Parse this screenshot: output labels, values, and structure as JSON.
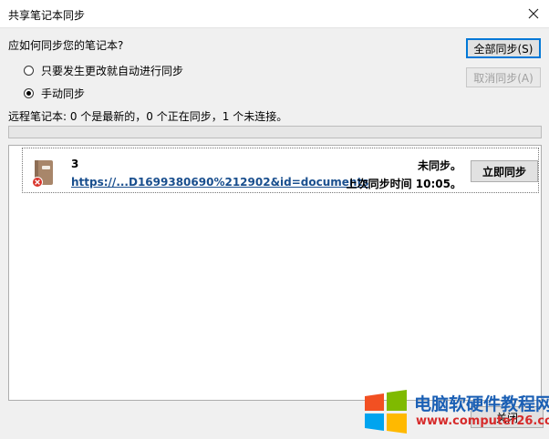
{
  "window": {
    "title": "共享笔记本同步"
  },
  "question": "应如何同步您的笔记本?",
  "options": [
    {
      "label": "只要发生更改就自动进行同步",
      "selected": false
    },
    {
      "label": "手动同步",
      "selected": true
    }
  ],
  "buttons": {
    "sync_all": "全部同步(S)",
    "cancel_sync": "取消同步(A)",
    "close": "关闭"
  },
  "status_text": "远程笔记本: 0 个是最新的，0 个正在同步，1 个未连接。",
  "notebooks": [
    {
      "name": "3",
      "url": "https://...D1699380690%212902&id=documents",
      "state": "未同步。",
      "last_sync": "上次同步时间 10:05。",
      "action": "立即同步"
    }
  ],
  "watermark": {
    "title": "电脑软硬件教程网",
    "url": "www.computer26.com"
  },
  "colors": {
    "link": "#1a4f8e",
    "error": "#d9342b",
    "notebook_icon": "#a8866a"
  }
}
